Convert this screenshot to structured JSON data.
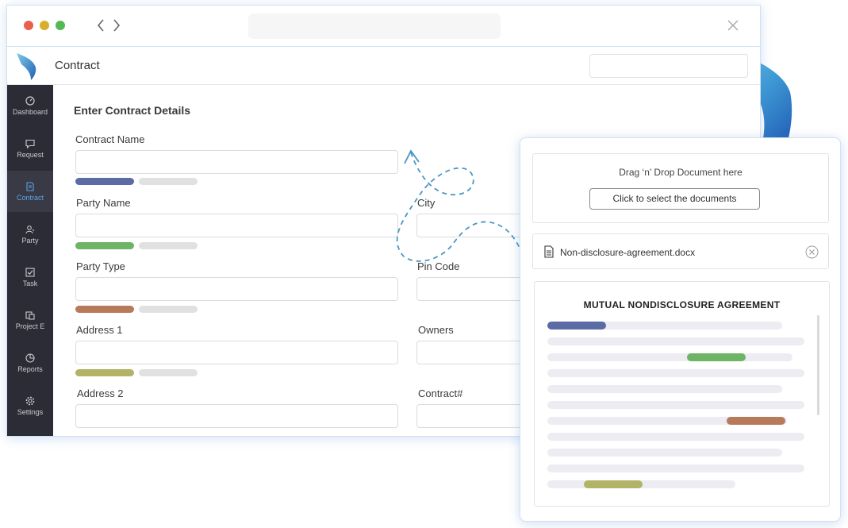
{
  "app": {
    "title": "Contract"
  },
  "sidebar": {
    "items": [
      {
        "label": "Dashboard",
        "icon": "dashboard-icon"
      },
      {
        "label": "Request",
        "icon": "chat-icon"
      },
      {
        "label": "Contract",
        "icon": "contract-icon",
        "active": true
      },
      {
        "label": "Party",
        "icon": "users-icon"
      },
      {
        "label": "Task",
        "icon": "task-icon"
      },
      {
        "label": "Project E",
        "icon": "project-icon"
      },
      {
        "label": "Reports",
        "icon": "reports-icon"
      },
      {
        "label": "Settings",
        "icon": "gear-icon"
      }
    ]
  },
  "form": {
    "title": "Enter Contract Details",
    "fields": {
      "contract_name": "Contract Name",
      "party_name": "Party Name",
      "city": "City",
      "party_type": "Party Type",
      "pin_code": "Pin Code",
      "address1": "Address 1",
      "owners": "Owners",
      "address2": "Address 2",
      "contract_no": "Contract#"
    }
  },
  "upload": {
    "drop_text": "Drag ‘n’ Drop Document here",
    "select_button": "Click to select the documents",
    "file_name": "Non-disclosure-agreement.docx",
    "preview_title": "MUTUAL NONDISCLOSURE AGREEMENT"
  },
  "colors": {
    "accent_blue": "#5b6ba6",
    "accent_green": "#6db464",
    "accent_brown": "#b77b5b",
    "accent_olive": "#b2b366",
    "sidebar_bg": "#2c2c36",
    "sidebar_active": "#5aa4e6",
    "window_border": "#cfe1f3"
  }
}
